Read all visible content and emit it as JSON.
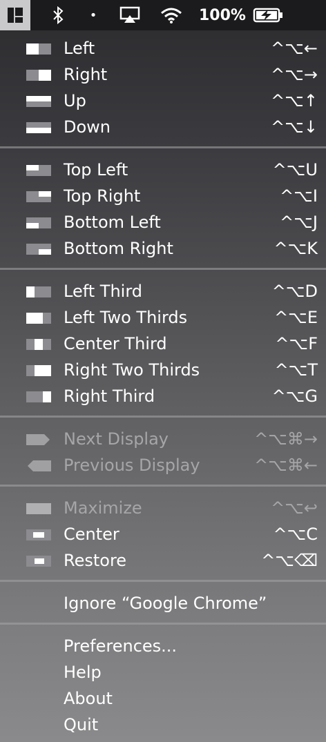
{
  "menubar": {
    "app_icon": "rectangle-app-icon",
    "bluetooth_icon": "bluetooth-icon",
    "dot": "•",
    "airplay_icon": "airplay-icon",
    "wifi_icon": "wifi-icon",
    "battery_percent": "100%",
    "battery_icon": "battery-charging-icon"
  },
  "menu": {
    "groups": [
      {
        "items": [
          {
            "label": "Left",
            "shortcut": "^⌥←",
            "icon": "left-half-icon",
            "enabled": true
          },
          {
            "label": "Right",
            "shortcut": "^⌥→",
            "icon": "right-half-icon",
            "enabled": true
          },
          {
            "label": "Up",
            "shortcut": "^⌥↑",
            "icon": "top-half-icon",
            "enabled": true
          },
          {
            "label": "Down",
            "shortcut": "^⌥↓",
            "icon": "bottom-half-icon",
            "enabled": true
          }
        ]
      },
      {
        "items": [
          {
            "label": "Top Left",
            "shortcut": "^⌥U",
            "icon": "top-left-icon",
            "enabled": true
          },
          {
            "label": "Top Right",
            "shortcut": "^⌥I",
            "icon": "top-right-icon",
            "enabled": true
          },
          {
            "label": "Bottom Left",
            "shortcut": "^⌥J",
            "icon": "bottom-left-icon",
            "enabled": true
          },
          {
            "label": "Bottom Right",
            "shortcut": "^⌥K",
            "icon": "bottom-right-icon",
            "enabled": true
          }
        ]
      },
      {
        "items": [
          {
            "label": "Left Third",
            "shortcut": "^⌥D",
            "icon": "left-third-icon",
            "enabled": true
          },
          {
            "label": "Left Two Thirds",
            "shortcut": "^⌥E",
            "icon": "left-two-thirds-icon",
            "enabled": true
          },
          {
            "label": "Center Third",
            "shortcut": "^⌥F",
            "icon": "center-third-icon",
            "enabled": true
          },
          {
            "label": "Right Two Thirds",
            "shortcut": "^⌥T",
            "icon": "right-two-thirds-icon",
            "enabled": true
          },
          {
            "label": "Right Third",
            "shortcut": "^⌥G",
            "icon": "right-third-icon",
            "enabled": true
          }
        ]
      },
      {
        "items": [
          {
            "label": "Next Display",
            "shortcut": "^⌥⌘→",
            "icon": "next-display-icon",
            "enabled": false
          },
          {
            "label": "Previous Display",
            "shortcut": "^⌥⌘←",
            "icon": "previous-display-icon",
            "enabled": false
          }
        ]
      },
      {
        "items": [
          {
            "label": "Maximize",
            "shortcut": "^⌥↩",
            "icon": "maximize-icon",
            "enabled": false
          },
          {
            "label": "Center",
            "shortcut": "^⌥C",
            "icon": "center-icon",
            "enabled": true
          },
          {
            "label": "Restore",
            "shortcut": "^⌥⌫",
            "icon": "restore-icon",
            "enabled": true
          }
        ]
      },
      {
        "items": [
          {
            "label": "Ignore “Google Chrome”",
            "shortcut": "",
            "icon": "",
            "enabled": true
          }
        ]
      },
      {
        "items": [
          {
            "label": "Preferences...",
            "shortcut": "",
            "icon": "",
            "enabled": true
          },
          {
            "label": "Help",
            "shortcut": "",
            "icon": "",
            "enabled": true
          },
          {
            "label": "About",
            "shortcut": "",
            "icon": "",
            "enabled": true
          },
          {
            "label": "Quit",
            "shortcut": "",
            "icon": "",
            "enabled": true
          }
        ]
      }
    ]
  }
}
